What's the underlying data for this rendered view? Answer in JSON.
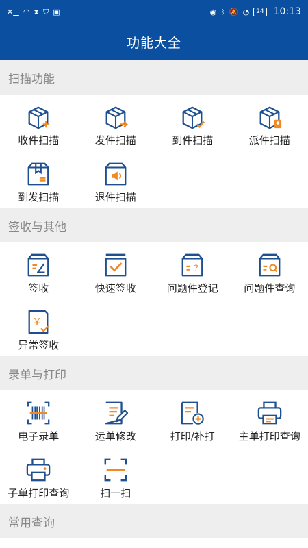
{
  "status_bar": {
    "time": "10:13",
    "battery": "24"
  },
  "header": {
    "title": "功能大全"
  },
  "sections": [
    {
      "title": "扫描功能",
      "items": [
        {
          "label": "收件扫描",
          "icon": "box-plus-icon"
        },
        {
          "label": "发件扫描",
          "icon": "box-arrow-icon"
        },
        {
          "label": "到件扫描",
          "icon": "box-check-icon"
        },
        {
          "label": "派件扫描",
          "icon": "box-courier-icon"
        },
        {
          "label": "到发扫描",
          "icon": "package-icon"
        },
        {
          "label": "退件扫描",
          "icon": "box-speaker-icon"
        }
      ]
    },
    {
      "title": "签收与其他",
      "items": [
        {
          "label": "签收",
          "icon": "sign-box-icon"
        },
        {
          "label": "快速签收",
          "icon": "quick-sign-icon"
        },
        {
          "label": "问题件登记",
          "icon": "question-box-icon"
        },
        {
          "label": "问题件查询",
          "icon": "search-box-icon"
        },
        {
          "label": "异常签收",
          "icon": "abnormal-sign-icon"
        }
      ]
    },
    {
      "title": "录单与打印",
      "items": [
        {
          "label": "电子录单",
          "icon": "barcode-scan-icon"
        },
        {
          "label": "运单修改",
          "icon": "edit-document-icon"
        },
        {
          "label": "打印/补打",
          "icon": "print-add-icon"
        },
        {
          "label": "主单打印查询",
          "icon": "printer-icon"
        },
        {
          "label": "子单打印查询",
          "icon": "printer-small-icon"
        },
        {
          "label": "扫一扫",
          "icon": "scan-frame-icon"
        }
      ]
    },
    {
      "title": "常用查询",
      "items": []
    }
  ],
  "colors": {
    "primary": "#0b4fa0",
    "icon_blue": "#1d4f91",
    "icon_orange": "#f08a24"
  }
}
